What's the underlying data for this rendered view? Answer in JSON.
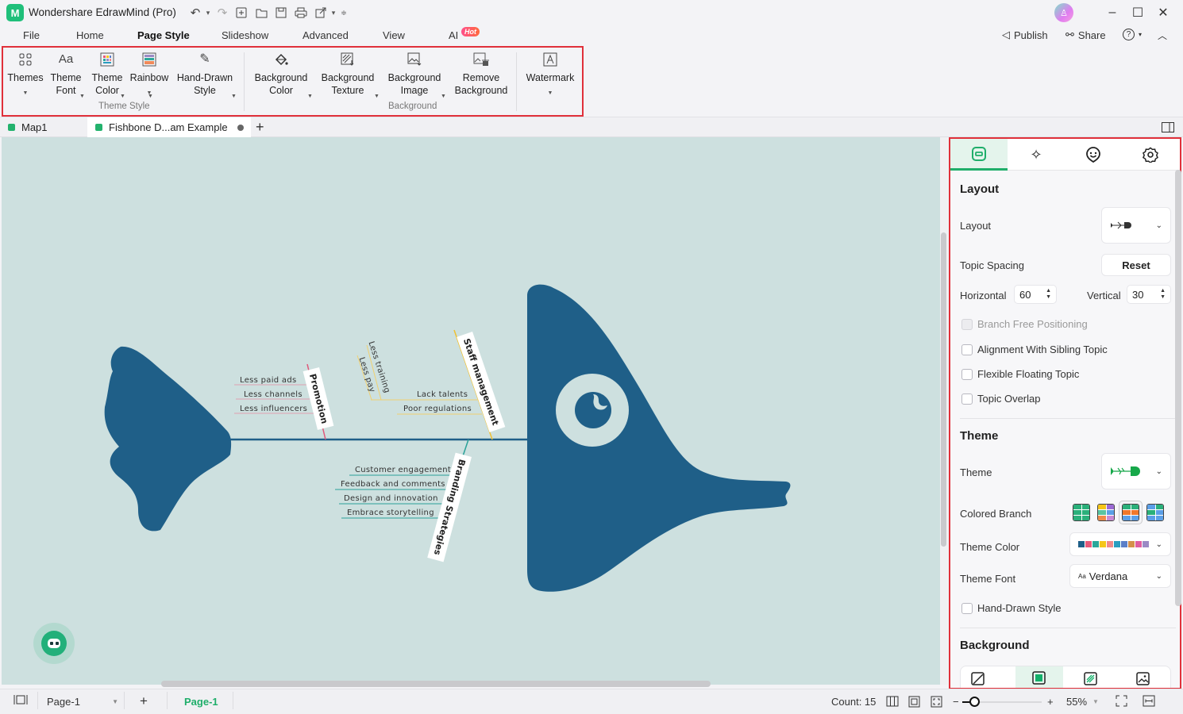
{
  "app": {
    "title": "Wondershare EdrawMind (Pro)",
    "logo_glyph": "M"
  },
  "quick_access": [
    "undo-icon",
    "redo-icon",
    "new-icon",
    "open-folder-icon",
    "save-icon",
    "print-icon",
    "export-icon",
    "customize-icon"
  ],
  "window_controls": {
    "minimize": "–",
    "maximize": "☐",
    "close": "✕"
  },
  "menu": {
    "items": [
      {
        "label": "File"
      },
      {
        "label": "Home"
      },
      {
        "label": "Page Style",
        "active": true
      },
      {
        "label": "Slideshow"
      },
      {
        "label": "Advanced"
      },
      {
        "label": "View"
      },
      {
        "label": "AI"
      }
    ],
    "ai_badge": "Hot",
    "publish": "Publish",
    "share": "Share",
    "help": "?"
  },
  "ribbon": {
    "theme_style": {
      "group_label": "Theme Style",
      "buttons": [
        {
          "line1": "Themes",
          "line2": "",
          "icon": "themes-grid-icon"
        },
        {
          "line1": "Theme",
          "line2": "Font",
          "icon": "font-aa-icon"
        },
        {
          "line1": "Theme",
          "line2": "Color",
          "icon": "theme-color-icon"
        },
        {
          "line1": "Rainbow",
          "line2": "",
          "icon": "rainbow-icon"
        },
        {
          "line1": "Hand-Drawn",
          "line2": "Style",
          "icon": "hand-drawn-icon"
        }
      ]
    },
    "background": {
      "group_label": "Background",
      "buttons": [
        {
          "line1": "Background",
          "line2": "Color",
          "icon": "paint-bucket-icon"
        },
        {
          "line1": "Background",
          "line2": "Texture",
          "icon": "texture-icon"
        },
        {
          "line1": "Background",
          "line2": "Image",
          "icon": "image-icon"
        },
        {
          "line1": "Remove",
          "line2": "Background",
          "icon": "remove-background-icon"
        }
      ]
    },
    "watermark": {
      "line1": "Watermark",
      "icon": "watermark-icon"
    }
  },
  "doc_tabs": [
    {
      "label": "Map1",
      "active": false
    },
    {
      "label": "Fishbone D...am Example",
      "active": true,
      "unsaved": true
    }
  ],
  "diagram": {
    "colors": {
      "fish": "#1f5f88",
      "spine": "#1f5f88",
      "canvas": "#cde0df",
      "promotion": "#e0577a",
      "staff": "#f0c030",
      "branding": "#2aa198"
    },
    "branches": [
      {
        "name": "Promotion",
        "leaves": [
          "Less paid ads",
          "Less channels",
          "Less influencers"
        ]
      },
      {
        "name": "Staff management",
        "leaves": [
          "Lack talents",
          "Poor regulations"
        ],
        "sub_leaves": [
          "Less training",
          "Less pay"
        ]
      },
      {
        "name": "Branding Strategies",
        "leaves": [
          "Customer engagement",
          "Feedback and comments",
          "Design and innovation",
          "Embrace storytelling"
        ]
      }
    ]
  },
  "panel": {
    "tabs": [
      "layout-tab-icon",
      "sparkle-style-icon",
      "emoji-icon",
      "settings-icon"
    ],
    "layout": {
      "heading": "Layout",
      "layout_label": "Layout",
      "topic_spacing_label": "Topic Spacing",
      "reset": "Reset",
      "horizontal_label": "Horizontal",
      "horizontal_value": "60",
      "vertical_label": "Vertical",
      "vertical_value": "30",
      "checkboxes": [
        {
          "label": "Branch Free Positioning",
          "disabled": true,
          "checked": false
        },
        {
          "label": "Alignment With Sibling Topic",
          "checked": false
        },
        {
          "label": "Flexible Floating Topic",
          "checked": false
        },
        {
          "label": "Topic Overlap",
          "checked": false
        }
      ]
    },
    "theme": {
      "heading": "Theme",
      "theme_label": "Theme",
      "colored_branch_label": "Colored Branch",
      "theme_color_label": "Theme Color",
      "theme_color_swatches": [
        "#1f5f88",
        "#e85a7a",
        "#2ba79a",
        "#f5c518",
        "#f08a8a",
        "#2a9dbf",
        "#5b7fc7",
        "#d4904a",
        "#e05ca0",
        "#9b8ac4"
      ],
      "theme_font_label": "Theme Font",
      "theme_font_prefix": "Aa",
      "theme_font_value": "Verdana",
      "hand_drawn_label": "Hand-Drawn Style"
    },
    "background": {
      "heading": "Background",
      "options": [
        "no-background-icon",
        "solid-color-icon",
        "texture-icon",
        "image-icon"
      ]
    }
  },
  "status": {
    "page_select": "Page-1",
    "page_tab": "Page-1",
    "count": "Count: 15",
    "zoom": "55%",
    "zoom_minus": "−",
    "zoom_plus": "+",
    "zoom_fraction": 0.15
  }
}
